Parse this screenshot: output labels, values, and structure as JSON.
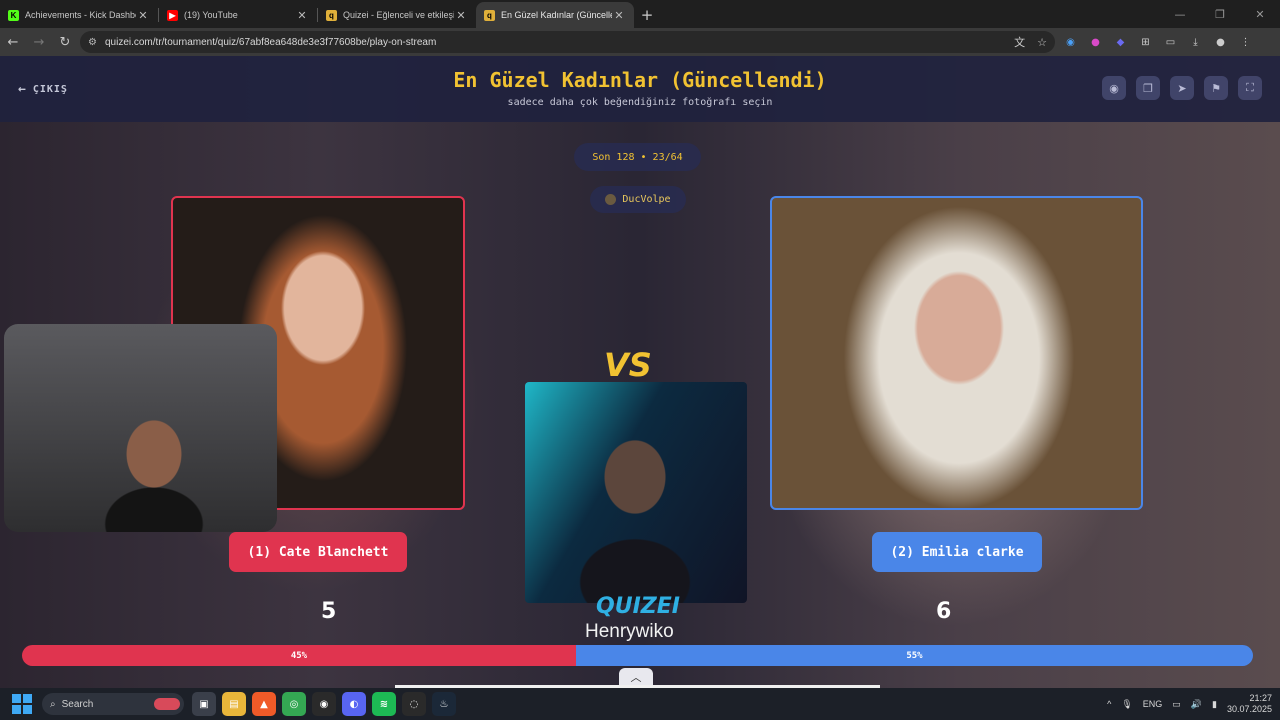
{
  "browser": {
    "tabs": [
      {
        "title": "Achievements - Kick Dashboard",
        "favicon": "K",
        "color": "#53fc18",
        "active": false
      },
      {
        "title": "(19) YouTube",
        "favicon": "▶",
        "color": "#ff0000",
        "active": false
      },
      {
        "title": "Quizei - Eğlenceli ve etkileşimli",
        "favicon": "q",
        "color": "#e0b03a",
        "active": false
      },
      {
        "title": "En Güzel Kadınlar (Güncellendi)",
        "favicon": "q",
        "color": "#e0b03a",
        "active": true
      }
    ],
    "url": "quizei.com/tr/tournament/quiz/67abf8ea648de3e3f77608be/play-on-stream"
  },
  "header": {
    "exit_label": "ÇIKIŞ",
    "title": "En Güzel Kadınlar (Güncellendi)",
    "subtitle": "sadece daha çok beğendiğiniz fotoğrafı seçin"
  },
  "round": {
    "label": "Son 128 • 23/64"
  },
  "user": {
    "name": "DucVolpe"
  },
  "vs_label": "VS",
  "brand_label": "QUIZEI",
  "streamer_name": "Henrywiko",
  "left": {
    "choice_label": "(1) Cate Blanchett",
    "score": "5",
    "percent_label": "45%",
    "percent": 45,
    "color": "#e0344f"
  },
  "right": {
    "choice_label": "(2) Emilia clarke",
    "score": "6",
    "percent_label": "55%",
    "percent": 55,
    "color": "#4a86e8"
  },
  "taskbar": {
    "search_placeholder": "Search",
    "language": "ENG",
    "time": "21:27",
    "date": "30.07.2025"
  }
}
